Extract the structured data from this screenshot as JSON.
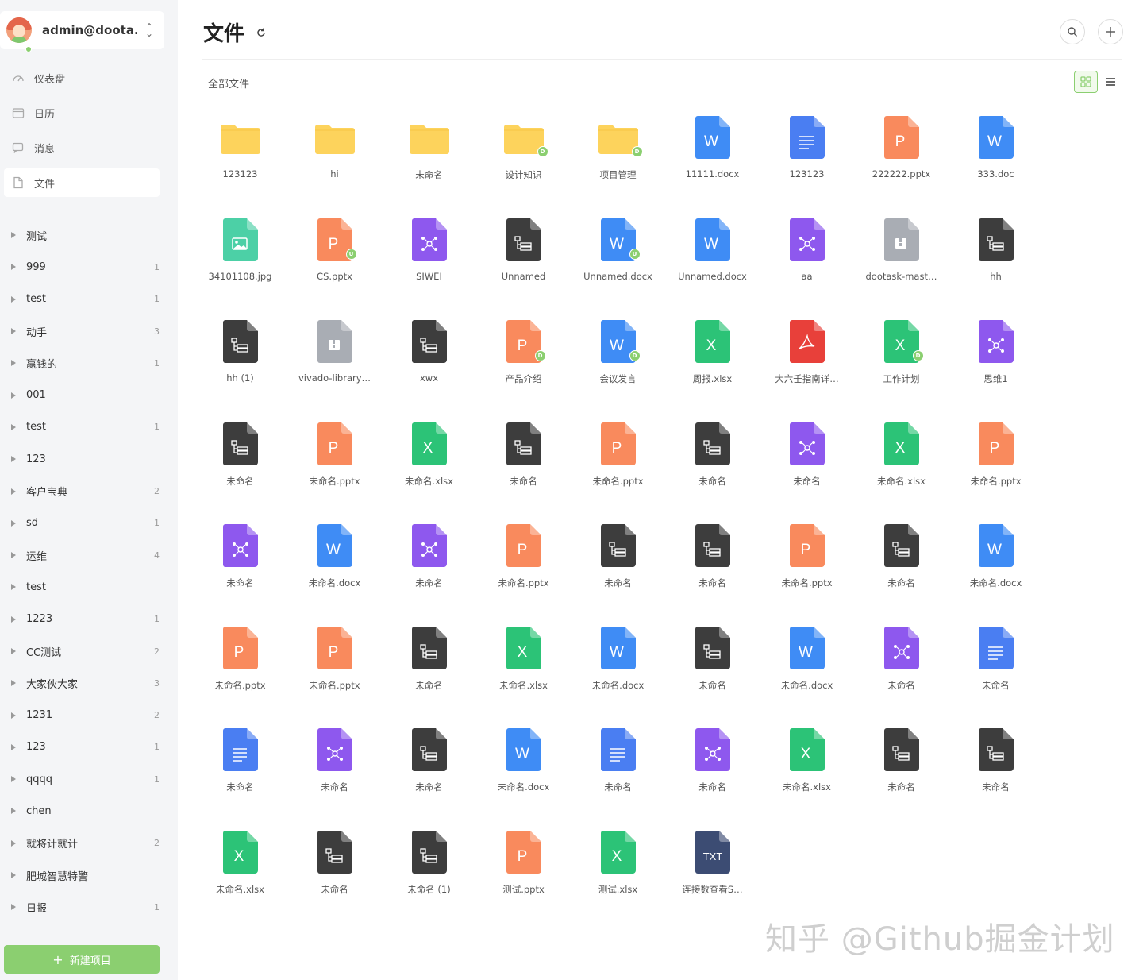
{
  "user": {
    "name": "admin@doota..."
  },
  "nav": [
    {
      "label": "仪表盘",
      "icon": "dashboard-icon",
      "active": false
    },
    {
      "label": "日历",
      "icon": "calendar-icon",
      "active": false
    },
    {
      "label": "消息",
      "icon": "message-icon",
      "active": false
    },
    {
      "label": "文件",
      "icon": "file-icon",
      "active": true
    }
  ],
  "projects": [
    {
      "name": "测试",
      "count": ""
    },
    {
      "name": "999",
      "count": "1"
    },
    {
      "name": "test",
      "count": "1"
    },
    {
      "name": "动手",
      "count": "3"
    },
    {
      "name": "赢钱的",
      "count": "1"
    },
    {
      "name": "001",
      "count": ""
    },
    {
      "name": "test",
      "count": "1"
    },
    {
      "name": "123",
      "count": ""
    },
    {
      "name": "客户宝典",
      "count": "2"
    },
    {
      "name": "sd",
      "count": "1"
    },
    {
      "name": "运维",
      "count": "4"
    },
    {
      "name": "test",
      "count": ""
    },
    {
      "name": "1223",
      "count": "1"
    },
    {
      "name": "CC测试",
      "count": "2"
    },
    {
      "name": "大家伙大家",
      "count": "3"
    },
    {
      "name": "1231",
      "count": "2"
    },
    {
      "name": "123",
      "count": "1"
    },
    {
      "name": "qqqq",
      "count": "1"
    },
    {
      "name": "chen",
      "count": ""
    },
    {
      "name": "就将计就计",
      "count": "2"
    },
    {
      "name": "肥城智慧特警",
      "count": ""
    },
    {
      "name": "日报",
      "count": "1"
    }
  ],
  "new_project_label": "新建项目",
  "page_title": "文件",
  "breadcrumb": "全部文件",
  "colors": {
    "folder": "#fdd35c",
    "word": "#3f8cf5",
    "ppt": "#f98a5d",
    "excel": "#2cc377",
    "mind": "#8e58ee",
    "flow": "#3d3d3d",
    "image": "#4cd0a6",
    "doc": "#4a7ef2",
    "pdf": "#e8403a",
    "archive": "#a9adb4",
    "txt": "#3c4c73",
    "accent": "#8bcf70"
  },
  "files": [
    {
      "name": "123123",
      "type": "folder",
      "badge": ""
    },
    {
      "name": "hi",
      "type": "folder",
      "badge": ""
    },
    {
      "name": "未命名",
      "type": "folder",
      "badge": ""
    },
    {
      "name": "设计知识",
      "type": "folder",
      "badge": "D"
    },
    {
      "name": "项目管理",
      "type": "folder",
      "badge": "D"
    },
    {
      "name": "11111.docx",
      "type": "word",
      "badge": ""
    },
    {
      "name": "123123",
      "type": "doc",
      "badge": ""
    },
    {
      "name": "222222.pptx",
      "type": "ppt",
      "badge": ""
    },
    {
      "name": "333.doc",
      "type": "word",
      "badge": ""
    },
    {
      "name": "34101108.jpg",
      "type": "image",
      "badge": ""
    },
    {
      "name": "CS.pptx",
      "type": "ppt",
      "badge": "U"
    },
    {
      "name": "SIWEI",
      "type": "mind",
      "badge": ""
    },
    {
      "name": "Unnamed",
      "type": "flow",
      "badge": ""
    },
    {
      "name": "Unnamed.docx",
      "type": "word",
      "badge": "U"
    },
    {
      "name": "Unnamed.docx",
      "type": "word",
      "badge": ""
    },
    {
      "name": "aa",
      "type": "mind",
      "badge": ""
    },
    {
      "name": "dootask-mast…",
      "type": "archive",
      "badge": ""
    },
    {
      "name": "hh",
      "type": "flow",
      "badge": ""
    },
    {
      "name": "hh (1)",
      "type": "flow",
      "badge": ""
    },
    {
      "name": "vivado-library…",
      "type": "archive",
      "badge": ""
    },
    {
      "name": "xwx",
      "type": "flow",
      "badge": ""
    },
    {
      "name": "产品介绍",
      "type": "ppt",
      "badge": "D"
    },
    {
      "name": "会议发言",
      "type": "word",
      "badge": "D"
    },
    {
      "name": "周报.xlsx",
      "type": "excel",
      "badge": ""
    },
    {
      "name": "大六壬指南详…",
      "type": "pdf",
      "badge": ""
    },
    {
      "name": "工作计划",
      "type": "excel",
      "badge": "D"
    },
    {
      "name": "思维1",
      "type": "mind",
      "badge": ""
    },
    {
      "name": "未命名",
      "type": "flow",
      "badge": ""
    },
    {
      "name": "未命名.pptx",
      "type": "ppt",
      "badge": ""
    },
    {
      "name": "未命名.xlsx",
      "type": "excel",
      "badge": ""
    },
    {
      "name": "未命名",
      "type": "flow",
      "badge": ""
    },
    {
      "name": "未命名.pptx",
      "type": "ppt",
      "badge": ""
    },
    {
      "name": "未命名",
      "type": "flow",
      "badge": ""
    },
    {
      "name": "未命名",
      "type": "mind",
      "badge": ""
    },
    {
      "name": "未命名.xlsx",
      "type": "excel",
      "badge": ""
    },
    {
      "name": "未命名.pptx",
      "type": "ppt",
      "badge": ""
    },
    {
      "name": "未命名",
      "type": "mind",
      "badge": ""
    },
    {
      "name": "未命名.docx",
      "type": "word",
      "badge": ""
    },
    {
      "name": "未命名",
      "type": "mind",
      "badge": ""
    },
    {
      "name": "未命名.pptx",
      "type": "ppt",
      "badge": ""
    },
    {
      "name": "未命名",
      "type": "flow",
      "badge": ""
    },
    {
      "name": "未命名",
      "type": "flow",
      "badge": ""
    },
    {
      "name": "未命名.pptx",
      "type": "ppt",
      "badge": ""
    },
    {
      "name": "未命名",
      "type": "flow",
      "badge": ""
    },
    {
      "name": "未命名.docx",
      "type": "word",
      "badge": ""
    },
    {
      "name": "未命名.pptx",
      "type": "ppt",
      "badge": ""
    },
    {
      "name": "未命名.pptx",
      "type": "ppt",
      "badge": ""
    },
    {
      "name": "未命名",
      "type": "flow",
      "badge": ""
    },
    {
      "name": "未命名.xlsx",
      "type": "excel",
      "badge": ""
    },
    {
      "name": "未命名.docx",
      "type": "word",
      "badge": ""
    },
    {
      "name": "未命名",
      "type": "flow",
      "badge": ""
    },
    {
      "name": "未命名.docx",
      "type": "word",
      "badge": ""
    },
    {
      "name": "未命名",
      "type": "mind",
      "badge": ""
    },
    {
      "name": "未命名",
      "type": "doc",
      "badge": ""
    },
    {
      "name": "未命名",
      "type": "doc",
      "badge": ""
    },
    {
      "name": "未命名",
      "type": "mind",
      "badge": ""
    },
    {
      "name": "未命名",
      "type": "flow",
      "badge": ""
    },
    {
      "name": "未命名.docx",
      "type": "word",
      "badge": ""
    },
    {
      "name": "未命名",
      "type": "doc",
      "badge": ""
    },
    {
      "name": "未命名",
      "type": "mind",
      "badge": ""
    },
    {
      "name": "未命名.xlsx",
      "type": "excel",
      "badge": ""
    },
    {
      "name": "未命名",
      "type": "flow",
      "badge": ""
    },
    {
      "name": "未命名",
      "type": "flow",
      "badge": ""
    },
    {
      "name": "未命名.xlsx",
      "type": "excel",
      "badge": ""
    },
    {
      "name": "未命名",
      "type": "flow",
      "badge": ""
    },
    {
      "name": "未命名 (1)",
      "type": "flow",
      "badge": ""
    },
    {
      "name": "测试.pptx",
      "type": "ppt",
      "badge": ""
    },
    {
      "name": "测试.xlsx",
      "type": "excel",
      "badge": ""
    },
    {
      "name": "连接数查看S…",
      "type": "txt",
      "badge": ""
    }
  ],
  "icon_letters": {
    "word": "W",
    "ppt": "P",
    "excel": "X",
    "txt": "TXT"
  },
  "watermark": "知乎 @Github掘金计划"
}
